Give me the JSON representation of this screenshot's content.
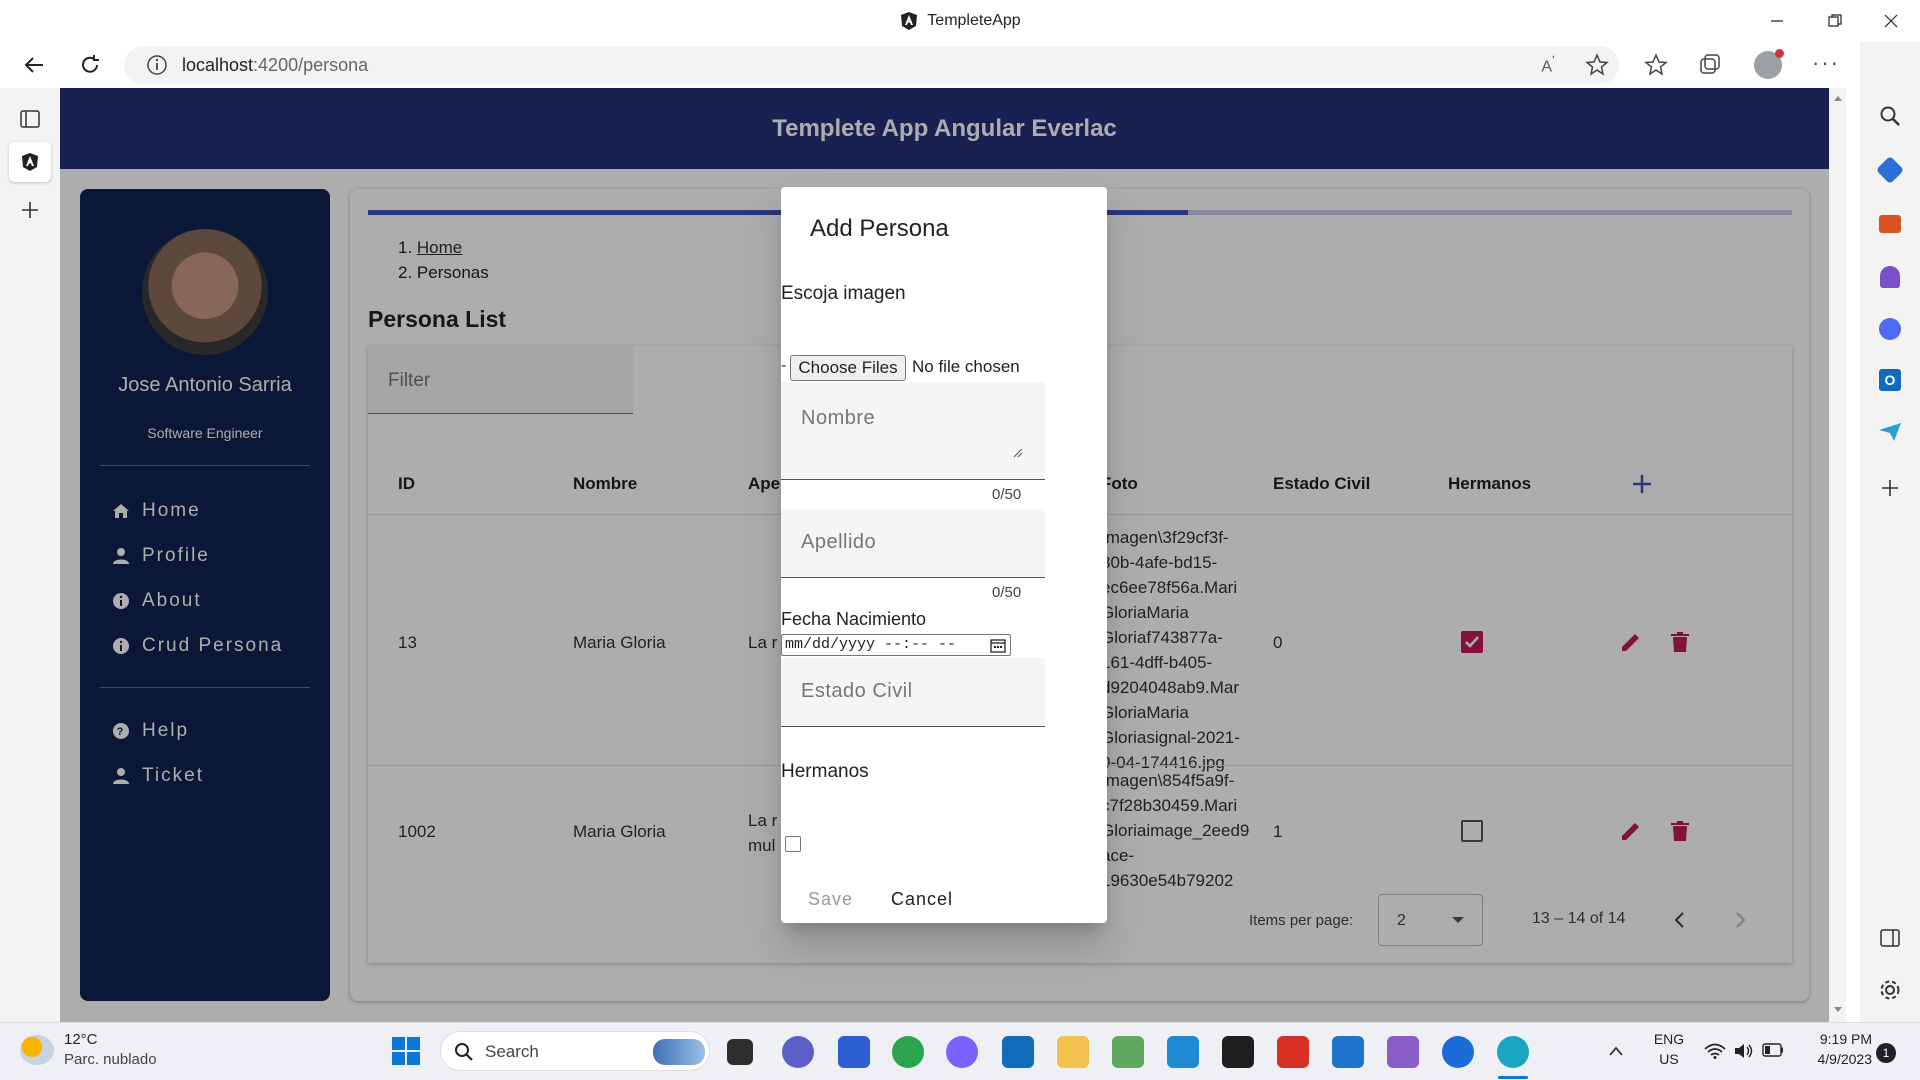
{
  "window": {
    "title": "TempleteApp"
  },
  "browser": {
    "url_host": "localhost",
    "url_path": ":4200/persona"
  },
  "app": {
    "header_title": "Templete App Angular Everlac"
  },
  "profile": {
    "name": "Jose Antonio Sarria",
    "role": "Software Engineer"
  },
  "nav": {
    "primary": [
      {
        "label": "Home",
        "icon": "home-icon"
      },
      {
        "label": "Profile",
        "icon": "person-icon"
      },
      {
        "label": "About",
        "icon": "info-icon"
      },
      {
        "label": "Crud Persona",
        "icon": "info-icon"
      }
    ],
    "secondary": [
      {
        "label": "Help",
        "icon": "help-icon"
      },
      {
        "label": "Ticket",
        "icon": "person-icon"
      }
    ]
  },
  "breadcrumb": [
    {
      "label": "Home",
      "link": true
    },
    {
      "label": "Personas",
      "link": false
    }
  ],
  "list": {
    "title": "Persona List",
    "filter_placeholder": "Filter",
    "columns": [
      "ID",
      "Nombre",
      "Ape",
      "Foto",
      "Estado Civil",
      "Hermanos"
    ],
    "rows": [
      {
        "id": "13",
        "nombre": "Maria Gloria",
        "apellido": "La r",
        "foto": [
          "Imagen\\3f29cf3f-",
          "80b-4afe-bd15-",
          "ec6ee78f56a.Mari",
          "GloriaMaria",
          "Gloriaf743877a-",
          "161-4dff-b405-",
          "d9204048ab9.Mar",
          "GloriaMaria",
          "Gloriasignal-2021-",
          "0-04-174416.jpg"
        ],
        "estado_civil": "0",
        "hermanos": true
      },
      {
        "id": "1002",
        "nombre": "Maria Gloria",
        "apellido": [
          "La r",
          "mul"
        ],
        "foto": [
          "Imagen\\854f5a9f-",
          "c7f28b30459.Mari",
          "Gloriaimage_2eed9",
          "ace-",
          "19630e54b79202"
        ],
        "estado_civil": "1",
        "hermanos": false
      }
    ],
    "paginator": {
      "items_per_page_label": "Items per page:",
      "items_per_page": "2",
      "range": "13 – 14 of 14"
    }
  },
  "dialog": {
    "title": "Add Persona",
    "image_label": "Escoja imagen",
    "file_prefix": "-",
    "file_button": "Choose Files",
    "file_status": "No file chosen",
    "nombre_placeholder": "Nombre",
    "nombre_counter": "0/50",
    "apellido_placeholder": "Apellido",
    "apellido_counter": "0/50",
    "fecha_label": "Fecha Nacimiento",
    "fecha_placeholder": "mm/dd/yyyy --:-- --",
    "estado_placeholder": "Estado Civil",
    "hermanos_label": "Hermanos",
    "hermanos_checked": false,
    "save_label": "Save",
    "cancel_label": "Cancel"
  },
  "taskbar": {
    "weather_temp": "12°C",
    "weather_desc": "Parc. nublado",
    "search_label": "Search",
    "lang_top": "ENG",
    "lang_bottom": "US",
    "time": "9:19 PM",
    "date": "4/9/2023",
    "notification_count": "1"
  },
  "colors": {
    "header": "#24317a",
    "sidebar": "#0f2350",
    "accent": "#c2185b",
    "primary": "#3d4fb8"
  }
}
